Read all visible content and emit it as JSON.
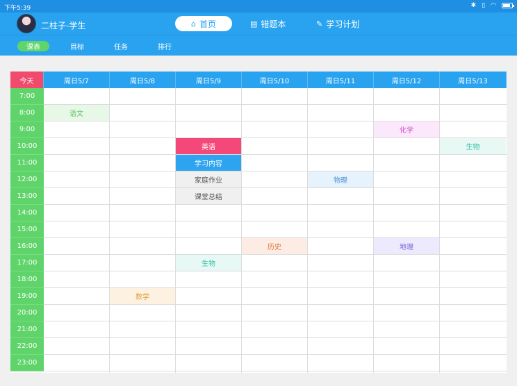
{
  "statusbar": {
    "time": "下午5:39",
    "icons": [
      "bluetooth-icon",
      "vibrate-icon",
      "wifi-icon",
      "battery-icon"
    ]
  },
  "header": {
    "username": "二柱子-学生",
    "tabs": [
      {
        "label": "首页",
        "icon": "home-icon",
        "active": true
      },
      {
        "label": "错题本",
        "icon": "notebook-icon",
        "active": false
      },
      {
        "label": "学习计划",
        "icon": "edit-icon",
        "active": false
      }
    ]
  },
  "subnav": [
    {
      "label": "课表",
      "active": true
    },
    {
      "label": "目标",
      "active": false
    },
    {
      "label": "任务",
      "active": false
    },
    {
      "label": "排行",
      "active": false
    }
  ],
  "schedule": {
    "corner_label": "今天",
    "days": [
      "周日5/7",
      "周日5/8",
      "周日5/9",
      "周日5/10",
      "周日5/11",
      "周日5/12",
      "周日5/13"
    ],
    "hours": [
      "7:00",
      "8:00",
      "9:00",
      "10:00",
      "11:00",
      "12:00",
      "13:00",
      "14:00",
      "15:00",
      "16:00",
      "17:00",
      "18:00",
      "19:00",
      "20:00",
      "21:00",
      "22:00",
      "23:00"
    ],
    "events": [
      {
        "label": "语文",
        "day": 0,
        "hour": 1,
        "bg": "#e8f8e6",
        "fg": "#5fc36a"
      },
      {
        "label": "化学",
        "day": 5,
        "hour": 2,
        "bg": "#fbe9fb",
        "fg": "#cf4fcf"
      },
      {
        "label": "英语",
        "day": 2,
        "hour": 3,
        "bg": "#f5487a",
        "fg": "#ffffff"
      },
      {
        "label": "生物",
        "day": 6,
        "hour": 3,
        "bg": "#e8f8f4",
        "fg": "#3cc2a8"
      },
      {
        "label": "学习内容",
        "day": 2,
        "hour": 4,
        "bg": "#2ea3ef",
        "fg": "#ffffff"
      },
      {
        "label": "物理",
        "day": 4,
        "hour": 5,
        "bg": "#e6f2fc",
        "fg": "#4a90d9"
      },
      {
        "label": "家庭作业",
        "day": 2,
        "hour": 5,
        "bg": "#f0f0f0",
        "fg": "#555555"
      },
      {
        "label": "课堂总结",
        "day": 2,
        "hour": 6,
        "bg": "#f0f0f0",
        "fg": "#555555"
      },
      {
        "label": "历史",
        "day": 3,
        "hour": 9,
        "bg": "#fdece4",
        "fg": "#e0763c"
      },
      {
        "label": "地理",
        "day": 5,
        "hour": 9,
        "bg": "#eeeafd",
        "fg": "#7a66d8"
      },
      {
        "label": "生物",
        "day": 2,
        "hour": 10,
        "bg": "#e8f8f4",
        "fg": "#3cc2a8"
      },
      {
        "label": "数学",
        "day": 1,
        "hour": 12,
        "bg": "#fdf1e2",
        "fg": "#e0a040"
      }
    ]
  }
}
